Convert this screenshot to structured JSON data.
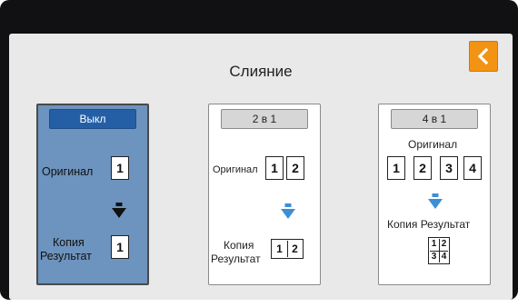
{
  "screen": {
    "title": "Слияние",
    "back_icon": "chevron-left-icon",
    "accent": "#f39314"
  },
  "options": [
    {
      "mode": "Выкл",
      "selected": true,
      "original_label": "Оригинал",
      "result_label_line1": "Копия",
      "result_label_line2": "Результат",
      "original_pages": [
        "1"
      ],
      "result_pages": [
        "1"
      ],
      "arrow_icon": "arrow-down-icon",
      "arrow_color": "#111111",
      "background": "#6d93bf"
    },
    {
      "mode": "2 в 1",
      "selected": false,
      "original_label": "Оригинал",
      "result_label_line1": "Копия",
      "result_label_line2": "Результат",
      "original_pages": [
        "1",
        "2"
      ],
      "result_pages": [
        "1",
        "2"
      ],
      "arrow_icon": "arrow-down-icon",
      "arrow_color": "#3a8fd6"
    },
    {
      "mode": "4 в 1",
      "selected": false,
      "original_label": "Оригинал",
      "result_label": "Копия Результат",
      "original_pages": [
        "1",
        "2",
        "3",
        "4"
      ],
      "result_pages": [
        "1",
        "2",
        "3",
        "4"
      ],
      "arrow_icon": "arrow-down-icon",
      "arrow_color": "#3a8fd6"
    }
  ]
}
